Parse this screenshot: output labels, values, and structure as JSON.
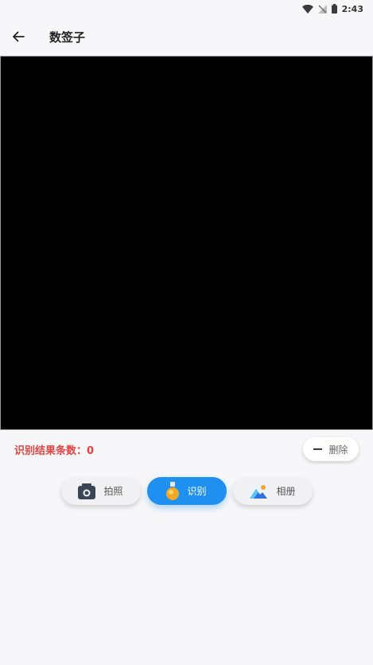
{
  "status_bar": {
    "time": "2:43",
    "icons": [
      "wifi-icon",
      "no-signal-icon",
      "battery-icon"
    ]
  },
  "app_bar": {
    "back_icon": "arrow-left-icon",
    "title": "数签子"
  },
  "result": {
    "count_label": "识别结果条数：0",
    "delete_label": "删除",
    "delete_icon": "minus-icon"
  },
  "actions": {
    "capture_label": "拍照",
    "capture_icon": "camera-icon",
    "recognize_label": "识别",
    "recognize_icon": "bulb-icon",
    "album_label": "相册",
    "album_icon": "image-icon"
  },
  "colors": {
    "accent": "#1f8ff0",
    "count_text": "#e64340",
    "preview_bg": "#000000"
  }
}
